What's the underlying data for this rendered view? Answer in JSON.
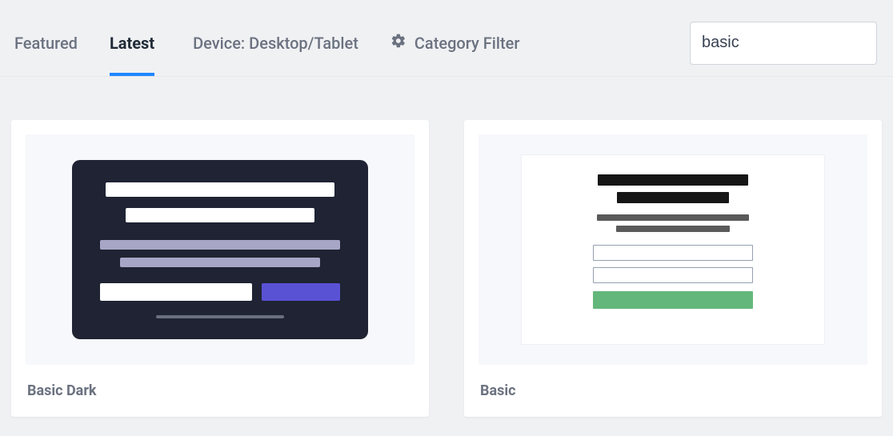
{
  "tabs": {
    "featured": "Featured",
    "latest": "Latest",
    "device": "Device: Desktop/Tablet",
    "active": "latest"
  },
  "category_filter": {
    "label": "Category Filter"
  },
  "search": {
    "value": "basic",
    "placeholder": ""
  },
  "cards": [
    {
      "title": "Basic Dark"
    },
    {
      "title": "Basic"
    }
  ]
}
